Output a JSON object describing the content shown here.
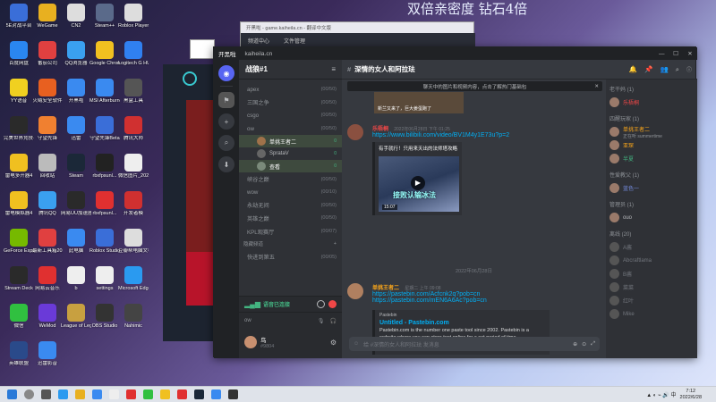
{
  "desktop": {
    "icons": [
      {
        "label": "5E对战平台",
        "c": "#3a6ed8"
      },
      {
        "label": "WeGame",
        "c": "#e8b020"
      },
      {
        "label": "CN2",
        "c": "#ddd"
      },
      {
        "label": "Steam++",
        "c": "#5a6a8a"
      },
      {
        "label": "Roblox Player",
        "c": "#ddd"
      },
      {
        "label": "百度网盘",
        "c": "#2a86f0"
      },
      {
        "label": "番茄公司",
        "c": "#e04040"
      },
      {
        "label": "QQ浏览器",
        "c": "#3aa0f0"
      },
      {
        "label": "Google Chrome",
        "c": "#f0c020"
      },
      {
        "label": "Logitech G HUB",
        "c": "#3080f0"
      },
      {
        "label": "YY语音",
        "c": "#f0d020"
      },
      {
        "label": "火绒安全软件",
        "c": "#e86020"
      },
      {
        "label": "开黑啦",
        "c": "#3a8af0"
      },
      {
        "label": "MSI Afterburner",
        "c": "#3a8af0"
      },
      {
        "label": "黑盒工具",
        "c": "#555"
      },
      {
        "label": "完美世界竞技平台",
        "c": "#2a2a2a"
      },
      {
        "label": "守望先锋",
        "c": "#f08030"
      },
      {
        "label": "迅雷",
        "c": "#3a8af0"
      },
      {
        "label": "守望先锋Beta",
        "c": "#3a6ed8"
      },
      {
        "label": "腾讯大师",
        "c": "#d03030"
      },
      {
        "label": "雷电多开器4",
        "c": "#f0c020"
      },
      {
        "label": "回收站",
        "c": "#bbb"
      },
      {
        "label": "Steam",
        "c": "#1b2838"
      },
      {
        "label": "rbxfpsunl...",
        "c": "#222"
      },
      {
        "label": "微信图片_2022061...",
        "c": "#eee"
      },
      {
        "label": "雷电模拟器4",
        "c": "#f0c020"
      },
      {
        "label": "腾讯QQ",
        "c": "#3aa0f0"
      },
      {
        "label": "网易UU加速器",
        "c": "#2a2a2a"
      },
      {
        "label": "rbxfpsunl...",
        "c": "#e03030"
      },
      {
        "label": "开发者模",
        "c": "#d03030"
      },
      {
        "label": "GeForce Experience",
        "c": "#76b900"
      },
      {
        "label": "最新工具箱2022",
        "c": "#e04040"
      },
      {
        "label": "此电脑",
        "c": "#3a8af0"
      },
      {
        "label": "Roblox Studio",
        "c": "#3a6ed8"
      },
      {
        "label": "豆瓣帮电脑文档集",
        "c": "#ddd"
      },
      {
        "label": "Stream Deck",
        "c": "#2a2a2a"
      },
      {
        "label": "网易云音乐",
        "c": "#e03030"
      },
      {
        "label": "b",
        "c": "#eee"
      },
      {
        "label": "settings",
        "c": "#eee"
      },
      {
        "label": "Microsoft Edge",
        "c": "#2a9af0"
      },
      {
        "label": "微信",
        "c": "#30c040"
      },
      {
        "label": "WeMod",
        "c": "#6a3ad8"
      },
      {
        "label": "League of Legends",
        "c": "#c8a040"
      },
      {
        "label": "OBS Studio",
        "c": "#333"
      },
      {
        "label": "Nahimic",
        "c": "#444"
      },
      {
        "label": "英雄联盟",
        "c": "#2a4a8a"
      },
      {
        "label": "迅雷影音",
        "c": "#3a8af0"
      }
    ]
  },
  "banner": {
    "text": "双倍亲密度 钻石4倍"
  },
  "back_window": {
    "title": "开黑啦 - game.kaiheila.cn - 翻译中文版",
    "tab1": "频道中心",
    "tab2": "文件管理"
  },
  "discord": {
    "app_name": "开黑啦",
    "url": "kaiheila.cn",
    "server_name": "战狼#1",
    "channel_title": "深情的女人和阿拉珐",
    "banner_note": "聊天中的图片和视频内容，点击了解热门基础包",
    "banner_close": "✕",
    "channels": [
      {
        "name": "apex",
        "count": "(00/50)"
      },
      {
        "name": "三国之争",
        "count": "(00/50)"
      },
      {
        "name": "csgo",
        "count": "(00/50)"
      },
      {
        "name": "ow",
        "count": "(00/50)"
      }
    ],
    "voice_users": [
      {
        "name": "单挑王者二",
        "tag": "0"
      },
      {
        "name": "SprataV",
        "tag": "0"
      },
      {
        "name": "查看",
        "tag": "0"
      }
    ],
    "channels2": [
      {
        "name": "峡谷之巅",
        "count": "(00/50)"
      },
      {
        "name": "wow",
        "count": "(00/10)"
      },
      {
        "name": "永劫无间",
        "count": "(00/50)"
      },
      {
        "name": "英雄之巅",
        "count": "(00/50)"
      },
      {
        "name": "KPL观赛厅",
        "count": "(00/07)"
      }
    ],
    "section_label": "隐藏频道",
    "channel_last": {
      "name": "快进到第五",
      "count": "(00/05)"
    },
    "voice_status": "语音已连接",
    "voice_sub": "ow",
    "user_name": "鸟",
    "user_tag": "#9804",
    "messages": [
      {
        "author": "乐梧桐",
        "time": "2022年06月28日 下午 01:25",
        "link": "https://www.bilibili.com/video/BV1M4y1E73u?p=2",
        "embed_title": "有手就行！只用来天出的法师塔攻略",
        "video_title": "接败认输冰法",
        "duration": "15:07"
      },
      {
        "author": "单挑王者二",
        "time": "星期二 上午 09:08",
        "link": "https://pastebin.com/Acfcnk2q?pob=cn",
        "link2": "https://pastebin.com/mEN6A6Ac?pob=cn",
        "embed_src": "Pastebin",
        "embed_title": "Untitled - Pastebin.com",
        "embed_desc": "Pastebin.com is the number one paste tool since 2002. Pastebin is a website where you can store text online for a set period of time."
      }
    ],
    "date_divider": "2022年06月28日",
    "earlier_embed_caption": "新兰又来了，巨大姜蛋跑了",
    "input_placeholder": "给 #深情的女人和阿拉珐 发消息",
    "members": [
      {
        "header": "老干妈 (1)",
        "items": [
          {
            "name": "乐梧桐",
            "c": "#f04747"
          }
        ]
      },
      {
        "header": "四醒玩家 (1)",
        "items": [
          {
            "name": "单挑王者二",
            "sub": "正在听 summertime",
            "c": "#faa61a"
          },
          {
            "name": "亚琛",
            "c": "#faa61a"
          },
          {
            "name": "半夏",
            "c": "#43b581"
          }
        ]
      },
      {
        "header": "性爱教父 (1)",
        "items": [
          {
            "name": "蓝色一",
            "c": "#7289da"
          }
        ]
      },
      {
        "header": "管理员 (1)",
        "items": [
          {
            "name": "ouo",
            "c": "#b9bbbe"
          }
        ]
      },
      {
        "header": "离线 (20)",
        "items": [
          {
            "name": "A酱",
            "c": "#72767d"
          },
          {
            "name": "Abcraftlama",
            "c": "#72767d"
          },
          {
            "name": "B酱",
            "c": "#72767d"
          },
          {
            "name": "菜菜",
            "c": "#72767d"
          },
          {
            "name": "红叶",
            "c": "#72767d"
          },
          {
            "name": "Mike",
            "c": "#72767d"
          }
        ]
      }
    ]
  },
  "taskbar": {
    "time": "7:12",
    "date": "2022/6/28"
  }
}
